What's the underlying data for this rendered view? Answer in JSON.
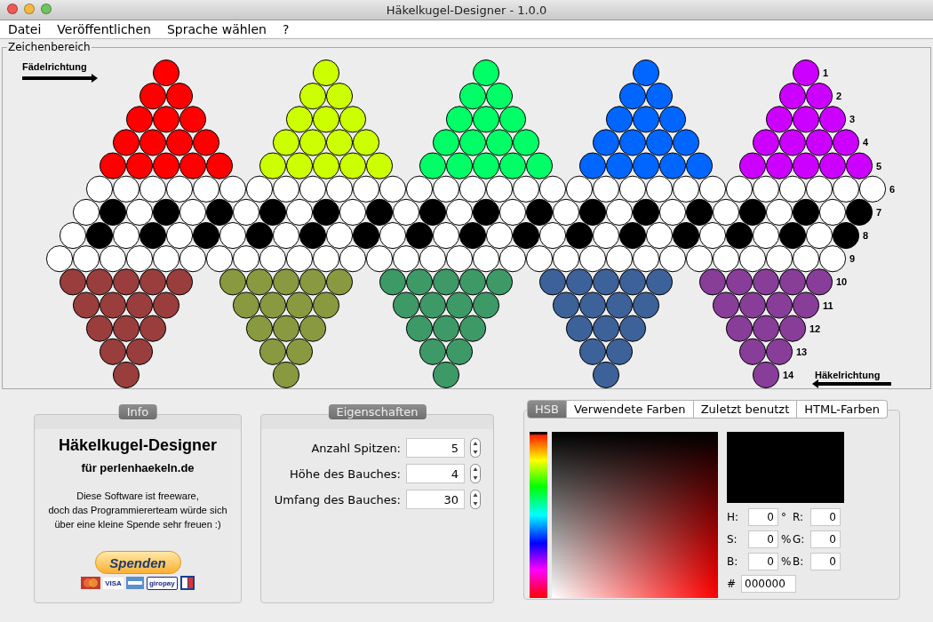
{
  "window": {
    "title": "Häkelkugel-Designer - 1.0.0"
  },
  "menu": [
    "Datei",
    "Veröffentlichen",
    "Sprache wählen",
    "?"
  ],
  "drawing_area": {
    "title": "Zeichenbereich",
    "threading_direction": "Fädelrichtung",
    "crochet_direction": "Häkelrichtung",
    "rows": [
      {
        "label": "1",
        "kind": "top",
        "beads": [
          {
            "color": "#ff0000"
          },
          {
            "color": "#ccff00"
          },
          {
            "color": "#00ff66"
          },
          {
            "color": "#0066ff"
          },
          {
            "color": "#cc00ff"
          }
        ]
      },
      {
        "label": "2",
        "kind": "top",
        "beads": [
          {
            "color": "#ff0000"
          },
          {
            "color": "#ff0000"
          },
          {
            "color": "#ccff00"
          },
          {
            "color": "#ccff00"
          },
          {
            "color": "#00ff66"
          },
          {
            "color": "#00ff66"
          },
          {
            "color": "#0066ff"
          },
          {
            "color": "#0066ff"
          },
          {
            "color": "#cc00ff"
          },
          {
            "color": "#cc00ff"
          }
        ]
      },
      {
        "label": "3",
        "kind": "top",
        "beads": [
          {
            "color": "#ff0000"
          },
          {
            "color": "#ff0000"
          },
          {
            "color": "#ff0000"
          },
          {
            "color": "#ccff00"
          },
          {
            "color": "#ccff00"
          },
          {
            "color": "#ccff00"
          },
          {
            "color": "#00ff66"
          },
          {
            "color": "#00ff66"
          },
          {
            "color": "#00ff66"
          },
          {
            "color": "#0066ff"
          },
          {
            "color": "#0066ff"
          },
          {
            "color": "#0066ff"
          },
          {
            "color": "#cc00ff"
          },
          {
            "color": "#cc00ff"
          },
          {
            "color": "#cc00ff"
          }
        ]
      },
      {
        "label": "4",
        "kind": "top",
        "beads": [
          {
            "color": "#ff0000"
          },
          {
            "color": "#ff0000"
          },
          {
            "color": "#ff0000"
          },
          {
            "color": "#ff0000"
          },
          {
            "color": "#ccff00"
          },
          {
            "color": "#ccff00"
          },
          {
            "color": "#ccff00"
          },
          {
            "color": "#ccff00"
          },
          {
            "color": "#00ff66"
          },
          {
            "color": "#00ff66"
          },
          {
            "color": "#00ff66"
          },
          {
            "color": "#00ff66"
          },
          {
            "color": "#0066ff"
          },
          {
            "color": "#0066ff"
          },
          {
            "color": "#0066ff"
          },
          {
            "color": "#0066ff"
          },
          {
            "color": "#cc00ff"
          },
          {
            "color": "#cc00ff"
          },
          {
            "color": "#cc00ff"
          },
          {
            "color": "#cc00ff"
          }
        ]
      },
      {
        "label": "5",
        "kind": "top",
        "beads": [
          {
            "color": "#ff0000"
          },
          {
            "color": "#ff0000"
          },
          {
            "color": "#ff0000"
          },
          {
            "color": "#ff0000"
          },
          {
            "color": "#ff0000"
          },
          {
            "color": "#ccff00"
          },
          {
            "color": "#ccff00"
          },
          {
            "color": "#ccff00"
          },
          {
            "color": "#ccff00"
          },
          {
            "color": "#ccff00"
          },
          {
            "color": "#00ff66"
          },
          {
            "color": "#00ff66"
          },
          {
            "color": "#00ff66"
          },
          {
            "color": "#00ff66"
          },
          {
            "color": "#00ff66"
          },
          {
            "color": "#0066ff"
          },
          {
            "color": "#0066ff"
          },
          {
            "color": "#0066ff"
          },
          {
            "color": "#0066ff"
          },
          {
            "color": "#0066ff"
          },
          {
            "color": "#cc00ff"
          },
          {
            "color": "#cc00ff"
          },
          {
            "color": "#cc00ff"
          },
          {
            "color": "#cc00ff"
          },
          {
            "color": "#cc00ff"
          }
        ]
      },
      {
        "label": "6",
        "kind": "belly",
        "beads": [
          {
            "color": "#ffffff"
          },
          {
            "color": "#ffffff"
          },
          {
            "color": "#ffffff"
          },
          {
            "color": "#ffffff"
          },
          {
            "color": "#ffffff"
          },
          {
            "color": "#ffffff"
          },
          {
            "color": "#ffffff"
          },
          {
            "color": "#ffffff"
          },
          {
            "color": "#ffffff"
          },
          {
            "color": "#ffffff"
          },
          {
            "color": "#ffffff"
          },
          {
            "color": "#ffffff"
          },
          {
            "color": "#ffffff"
          },
          {
            "color": "#ffffff"
          },
          {
            "color": "#ffffff"
          },
          {
            "color": "#ffffff"
          },
          {
            "color": "#ffffff"
          },
          {
            "color": "#ffffff"
          },
          {
            "color": "#ffffff"
          },
          {
            "color": "#ffffff"
          },
          {
            "color": "#ffffff"
          },
          {
            "color": "#ffffff"
          },
          {
            "color": "#ffffff"
          },
          {
            "color": "#ffffff"
          },
          {
            "color": "#ffffff"
          },
          {
            "color": "#ffffff"
          },
          {
            "color": "#ffffff"
          },
          {
            "color": "#ffffff"
          },
          {
            "color": "#ffffff"
          },
          {
            "color": "#ffffff"
          }
        ]
      },
      {
        "label": "7",
        "kind": "belly",
        "beads": [
          {
            "color": "#ffffff"
          },
          {
            "color": "#000000"
          },
          {
            "color": "#ffffff"
          },
          {
            "color": "#000000"
          },
          {
            "color": "#ffffff"
          },
          {
            "color": "#000000"
          },
          {
            "color": "#ffffff"
          },
          {
            "color": "#000000"
          },
          {
            "color": "#ffffff"
          },
          {
            "color": "#000000"
          },
          {
            "color": "#ffffff"
          },
          {
            "color": "#000000"
          },
          {
            "color": "#ffffff"
          },
          {
            "color": "#000000"
          },
          {
            "color": "#ffffff"
          },
          {
            "color": "#000000"
          },
          {
            "color": "#ffffff"
          },
          {
            "color": "#000000"
          },
          {
            "color": "#ffffff"
          },
          {
            "color": "#000000"
          },
          {
            "color": "#ffffff"
          },
          {
            "color": "#000000"
          },
          {
            "color": "#ffffff"
          },
          {
            "color": "#000000"
          },
          {
            "color": "#ffffff"
          },
          {
            "color": "#000000"
          },
          {
            "color": "#ffffff"
          },
          {
            "color": "#000000"
          },
          {
            "color": "#ffffff"
          },
          {
            "color": "#000000"
          }
        ]
      },
      {
        "label": "8",
        "kind": "belly",
        "beads": [
          {
            "color": "#ffffff"
          },
          {
            "color": "#000000"
          },
          {
            "color": "#ffffff"
          },
          {
            "color": "#000000"
          },
          {
            "color": "#ffffff"
          },
          {
            "color": "#000000"
          },
          {
            "color": "#ffffff"
          },
          {
            "color": "#000000"
          },
          {
            "color": "#ffffff"
          },
          {
            "color": "#000000"
          },
          {
            "color": "#ffffff"
          },
          {
            "color": "#000000"
          },
          {
            "color": "#ffffff"
          },
          {
            "color": "#000000"
          },
          {
            "color": "#ffffff"
          },
          {
            "color": "#000000"
          },
          {
            "color": "#ffffff"
          },
          {
            "color": "#000000"
          },
          {
            "color": "#ffffff"
          },
          {
            "color": "#000000"
          },
          {
            "color": "#ffffff"
          },
          {
            "color": "#000000"
          },
          {
            "color": "#ffffff"
          },
          {
            "color": "#000000"
          },
          {
            "color": "#ffffff"
          },
          {
            "color": "#000000"
          },
          {
            "color": "#ffffff"
          },
          {
            "color": "#000000"
          },
          {
            "color": "#ffffff"
          },
          {
            "color": "#000000"
          }
        ]
      },
      {
        "label": "9",
        "kind": "belly",
        "beads": [
          {
            "color": "#ffffff"
          },
          {
            "color": "#ffffff"
          },
          {
            "color": "#ffffff"
          },
          {
            "color": "#ffffff"
          },
          {
            "color": "#ffffff"
          },
          {
            "color": "#ffffff"
          },
          {
            "color": "#ffffff"
          },
          {
            "color": "#ffffff"
          },
          {
            "color": "#ffffff"
          },
          {
            "color": "#ffffff"
          },
          {
            "color": "#ffffff"
          },
          {
            "color": "#ffffff"
          },
          {
            "color": "#ffffff"
          },
          {
            "color": "#ffffff"
          },
          {
            "color": "#ffffff"
          },
          {
            "color": "#ffffff"
          },
          {
            "color": "#ffffff"
          },
          {
            "color": "#ffffff"
          },
          {
            "color": "#ffffff"
          },
          {
            "color": "#ffffff"
          },
          {
            "color": "#ffffff"
          },
          {
            "color": "#ffffff"
          },
          {
            "color": "#ffffff"
          },
          {
            "color": "#ffffff"
          },
          {
            "color": "#ffffff"
          },
          {
            "color": "#ffffff"
          },
          {
            "color": "#ffffff"
          },
          {
            "color": "#ffffff"
          },
          {
            "color": "#ffffff"
          },
          {
            "color": "#ffffff"
          }
        ]
      },
      {
        "label": "10",
        "kind": "bottom",
        "beads": [
          {
            "color": "#993d3d"
          },
          {
            "color": "#993d3d"
          },
          {
            "color": "#993d3d"
          },
          {
            "color": "#993d3d"
          },
          {
            "color": "#993d3d"
          },
          {
            "color": "#889940"
          },
          {
            "color": "#889940"
          },
          {
            "color": "#889940"
          },
          {
            "color": "#889940"
          },
          {
            "color": "#889940"
          },
          {
            "color": "#3d9966"
          },
          {
            "color": "#3d9966"
          },
          {
            "color": "#3d9966"
          },
          {
            "color": "#3d9966"
          },
          {
            "color": "#3d9966"
          },
          {
            "color": "#3d6199"
          },
          {
            "color": "#3d6199"
          },
          {
            "color": "#3d6199"
          },
          {
            "color": "#3d6199"
          },
          {
            "color": "#3d6199"
          },
          {
            "color": "#883d99"
          },
          {
            "color": "#883d99"
          },
          {
            "color": "#883d99"
          },
          {
            "color": "#883d99"
          },
          {
            "color": "#883d99"
          }
        ]
      },
      {
        "label": "11",
        "kind": "bottom",
        "beads": [
          {
            "color": "#993d3d"
          },
          {
            "color": "#993d3d"
          },
          {
            "color": "#993d3d"
          },
          {
            "color": "#993d3d"
          },
          {
            "color": "#889940"
          },
          {
            "color": "#889940"
          },
          {
            "color": "#889940"
          },
          {
            "color": "#889940"
          },
          {
            "color": "#3d9966"
          },
          {
            "color": "#3d9966"
          },
          {
            "color": "#3d9966"
          },
          {
            "color": "#3d9966"
          },
          {
            "color": "#3d6199"
          },
          {
            "color": "#3d6199"
          },
          {
            "color": "#3d6199"
          },
          {
            "color": "#3d6199"
          },
          {
            "color": "#883d99"
          },
          {
            "color": "#883d99"
          },
          {
            "color": "#883d99"
          },
          {
            "color": "#883d99"
          }
        ]
      },
      {
        "label": "12",
        "kind": "bottom",
        "beads": [
          {
            "color": "#993d3d"
          },
          {
            "color": "#993d3d"
          },
          {
            "color": "#993d3d"
          },
          {
            "color": "#889940"
          },
          {
            "color": "#889940"
          },
          {
            "color": "#889940"
          },
          {
            "color": "#3d9966"
          },
          {
            "color": "#3d9966"
          },
          {
            "color": "#3d9966"
          },
          {
            "color": "#3d6199"
          },
          {
            "color": "#3d6199"
          },
          {
            "color": "#3d6199"
          },
          {
            "color": "#883d99"
          },
          {
            "color": "#883d99"
          },
          {
            "color": "#883d99"
          }
        ]
      },
      {
        "label": "13",
        "kind": "bottom",
        "beads": [
          {
            "color": "#993d3d"
          },
          {
            "color": "#993d3d"
          },
          {
            "color": "#889940"
          },
          {
            "color": "#889940"
          },
          {
            "color": "#3d9966"
          },
          {
            "color": "#3d9966"
          },
          {
            "color": "#3d6199"
          },
          {
            "color": "#3d6199"
          },
          {
            "color": "#883d99"
          },
          {
            "color": "#883d99"
          }
        ]
      },
      {
        "label": "14",
        "kind": "bottom",
        "beads": [
          {
            "color": "#993d3d"
          },
          {
            "color": "#889940"
          },
          {
            "color": "#3d9966"
          },
          {
            "color": "#3d6199"
          },
          {
            "color": "#883d99"
          }
        ]
      }
    ]
  },
  "info": {
    "title": "Info",
    "heading": "Häkelkugel-Designer",
    "subheading": "für perlenhaekeln.de",
    "text": "Diese Software ist freeware,\ndoch das Programmiererteam würde sich\nüber eine kleine Spende sehr freuen :)",
    "donate_button": "Spenden",
    "payment_logos": [
      "VISA",
      "giropay"
    ]
  },
  "properties": {
    "title": "Eigenschaften",
    "fields": [
      {
        "label": "Anzahl Spitzen:",
        "value": "5"
      },
      {
        "label": "Höhe des Bauches:",
        "value": "4"
      },
      {
        "label": "Umfang des Bauches:",
        "value": "30"
      }
    ]
  },
  "color_chooser": {
    "tabs": [
      {
        "label": "HSB",
        "selected": true
      },
      {
        "label": "Verwendete Farben",
        "selected": false
      },
      {
        "label": "Zuletzt benutzt",
        "selected": false
      },
      {
        "label": "HTML-Farben",
        "selected": false
      }
    ],
    "hue_slider": {
      "level": 0
    },
    "hsb_fields": [
      {
        "label": "H:",
        "value": "0",
        "unit": "°"
      },
      {
        "label": "S:",
        "value": "0",
        "unit": "%"
      },
      {
        "label": "B:",
        "value": "0",
        "unit": "%"
      }
    ],
    "rgb_fields": [
      {
        "label": "R:",
        "value": "0"
      },
      {
        "label": "G:",
        "value": "0"
      },
      {
        "label": "B:",
        "value": "0"
      }
    ],
    "hex_field": {
      "label": "#",
      "value": "000000"
    }
  }
}
